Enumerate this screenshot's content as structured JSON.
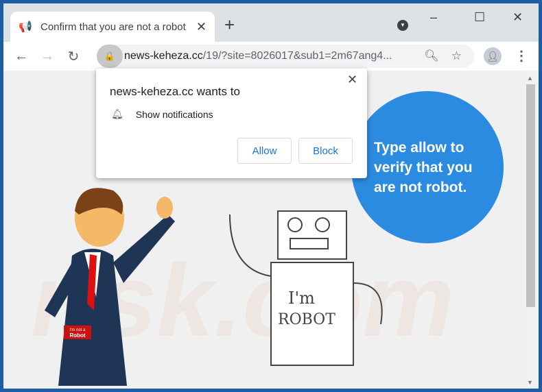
{
  "tab": {
    "title": "Confirm that you are not a robot",
    "close": "✕",
    "new": "+"
  },
  "window": {
    "minimize": "–",
    "maximize": "☐",
    "close": "✕"
  },
  "nav": {
    "back": "←",
    "forward": "→",
    "reload": "↻"
  },
  "address": {
    "host": "news-keheza.cc",
    "path": "/19/?site=8026017&sub1=2m67ang4..."
  },
  "permission_popup": {
    "title": "news-keheza.cc wants to",
    "permission": "Show notifications",
    "allow": "Allow",
    "block": "Block",
    "close": "✕"
  },
  "page": {
    "bubble": [
      "Type allow to",
      "verify that you",
      "are not robot."
    ],
    "badge": [
      "I'm not a",
      "Robot"
    ],
    "robot_text": [
      "I'm",
      "ROBOT"
    ],
    "watermark": "risk.com"
  },
  "colors": {
    "accent": "#1a73e8",
    "bubble": "#2a8be0",
    "frame": "#1b5ea6"
  }
}
